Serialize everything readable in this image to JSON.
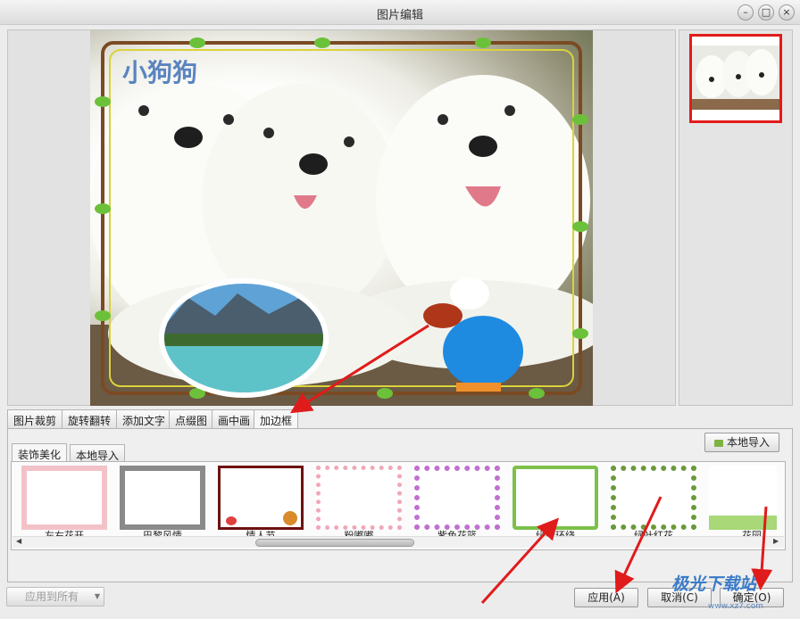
{
  "window": {
    "title": "图片编辑",
    "controls": [
      "–",
      "□",
      "×"
    ]
  },
  "photo": {
    "caption": "小狗狗"
  },
  "edit_tabs": [
    {
      "label": "图片裁剪",
      "active": false
    },
    {
      "label": "旋转翻转",
      "active": false
    },
    {
      "label": "添加文字",
      "active": false
    },
    {
      "label": "点缀图",
      "active": false
    },
    {
      "label": "画中画",
      "active": false
    },
    {
      "label": "加边框",
      "active": true
    }
  ],
  "sub_tabs": [
    {
      "label": "装饰美化",
      "active": true
    },
    {
      "label": "本地导入",
      "active": false
    }
  ],
  "local_import_button": "本地导入",
  "frames": [
    {
      "label": "左右花开",
      "color": "#e8a0a8"
    },
    {
      "label": "巴黎风情",
      "color": "#555555"
    },
    {
      "label": "情人节",
      "color": "#8a1a1a"
    },
    {
      "label": "粉嘟嘟",
      "color": "#f0b0c0"
    },
    {
      "label": "紫色花篮",
      "color": "#c070d0"
    },
    {
      "label": "绿叶环绕",
      "color": "#6ab04a"
    },
    {
      "label": "绿叶红花",
      "color": "#6a9a3a"
    },
    {
      "label": "花园",
      "color": "#8cc060"
    }
  ],
  "footer": {
    "apply_all": "应用到所有",
    "apply": "应用(A)",
    "cancel": "取消(C)",
    "ok": "确定(O)"
  },
  "watermark": {
    "text": "极光下载站",
    "sub": "www.xz7.com"
  },
  "colors": {
    "highlight_red": "#e21b1b",
    "arrow_red": "#e01b1b"
  }
}
